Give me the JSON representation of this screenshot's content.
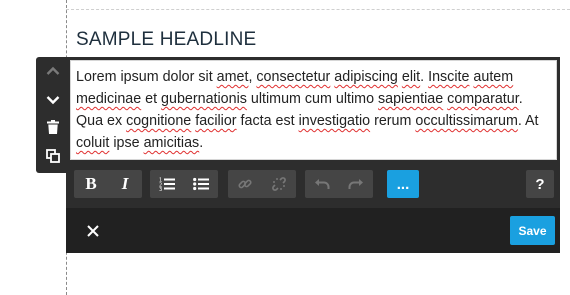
{
  "headline": "SAMPLE HEADLINE",
  "editor": {
    "segments": [
      {
        "text": "Lorem ipsum dolor sit ",
        "misspelled": false
      },
      {
        "text": "amet",
        "misspelled": true
      },
      {
        "text": ", ",
        "misspelled": false
      },
      {
        "text": "consectetur",
        "misspelled": true
      },
      {
        "text": " ",
        "misspelled": false
      },
      {
        "text": "adipiscing",
        "misspelled": true
      },
      {
        "text": " ",
        "misspelled": false
      },
      {
        "text": "elit",
        "misspelled": true
      },
      {
        "text": ". ",
        "misspelled": false
      },
      {
        "text": "Inscite",
        "misspelled": true
      },
      {
        "text": " ",
        "misspelled": false
      },
      {
        "text": "autem",
        "misspelled": true
      },
      {
        "text": " ",
        "misspelled": false
      },
      {
        "text": "medicinae",
        "misspelled": true
      },
      {
        "text": " et ",
        "misspelled": false
      },
      {
        "text": "gubernationis",
        "misspelled": true
      },
      {
        "text": " ultimum cum ultimo ",
        "misspelled": false
      },
      {
        "text": "sapientiae",
        "misspelled": true
      },
      {
        "text": " ",
        "misspelled": false
      },
      {
        "text": "comparatur",
        "misspelled": true
      },
      {
        "text": ". Qua ex ",
        "misspelled": false
      },
      {
        "text": "cognitione",
        "misspelled": true
      },
      {
        "text": " ",
        "misspelled": false
      },
      {
        "text": "facilior",
        "misspelled": true
      },
      {
        "text": " facta est ",
        "misspelled": false
      },
      {
        "text": "investigatio",
        "misspelled": true
      },
      {
        "text": " rerum ",
        "misspelled": false
      },
      {
        "text": "occultissimarum",
        "misspelled": true
      },
      {
        "text": ". At ",
        "misspelled": false
      },
      {
        "text": "coluit",
        "misspelled": true
      },
      {
        "text": " ipse ",
        "misspelled": false
      },
      {
        "text": "amicitias",
        "misspelled": true
      },
      {
        "text": ".",
        "misspelled": false
      }
    ]
  },
  "toolbar": {
    "bold_label": "B",
    "italic_label": "I",
    "more_label": "...",
    "help_label": "?"
  },
  "footer": {
    "save_label": "Save"
  },
  "icons": {
    "side": [
      "chevron-up-icon",
      "chevron-down-icon",
      "trash-icon",
      "copy-icon"
    ],
    "toolbar": [
      "ordered-list-icon",
      "unordered-list-icon",
      "link-icon",
      "unlink-icon",
      "undo-icon",
      "redo-icon"
    ],
    "footer": [
      "close-icon"
    ]
  },
  "colors": {
    "accent": "#1aa0e0",
    "panel": "#2d2d2d",
    "footer": "#212121",
    "button_group": "#454545",
    "spell_underline": "#e03030"
  }
}
